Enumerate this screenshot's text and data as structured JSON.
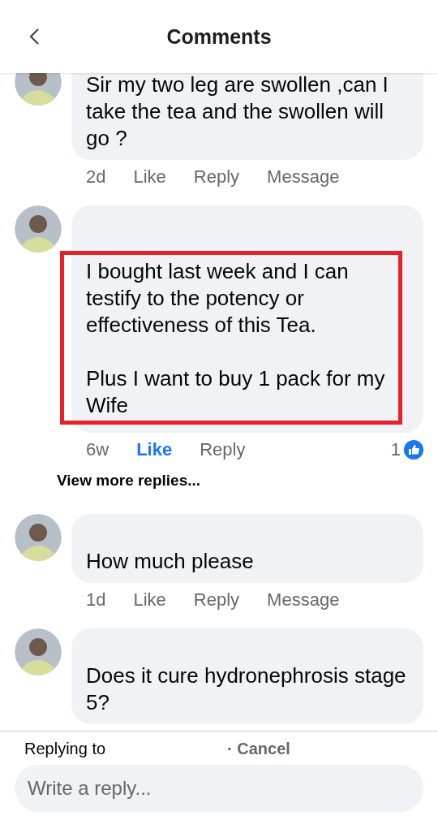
{
  "header": {
    "title": "Comments"
  },
  "comments": [
    {
      "highlighted": false,
      "paragraphs": [
        "Sir my two leg are swollen ,can I take the tea and the swollen will go ?"
      ],
      "time": "2d",
      "like": {
        "label": "Like",
        "selected": false
      },
      "reply": "Reply",
      "message": "Message"
    },
    {
      "highlighted": true,
      "paragraphs": [
        "I bought last week and I can testify to the potency or effectiveness of this Tea.",
        "Plus I want to buy 1 pack for my Wife"
      ],
      "time": "6w",
      "like": {
        "label": "Like",
        "selected": true
      },
      "reply": "Reply",
      "reaction_count": "1",
      "more_replies": "View more replies..."
    },
    {
      "highlighted": false,
      "paragraphs": [
        "How much please"
      ],
      "time": "1d",
      "like": {
        "label": "Like",
        "selected": false
      },
      "reply": "Reply",
      "message": "Message"
    },
    {
      "highlighted": false,
      "paragraphs": [
        "Does it cure hydronephrosis stage 5?"
      ]
    }
  ],
  "composer": {
    "replying_label": "Replying to",
    "cancel": "· Cancel",
    "placeholder": "Write a reply..."
  }
}
